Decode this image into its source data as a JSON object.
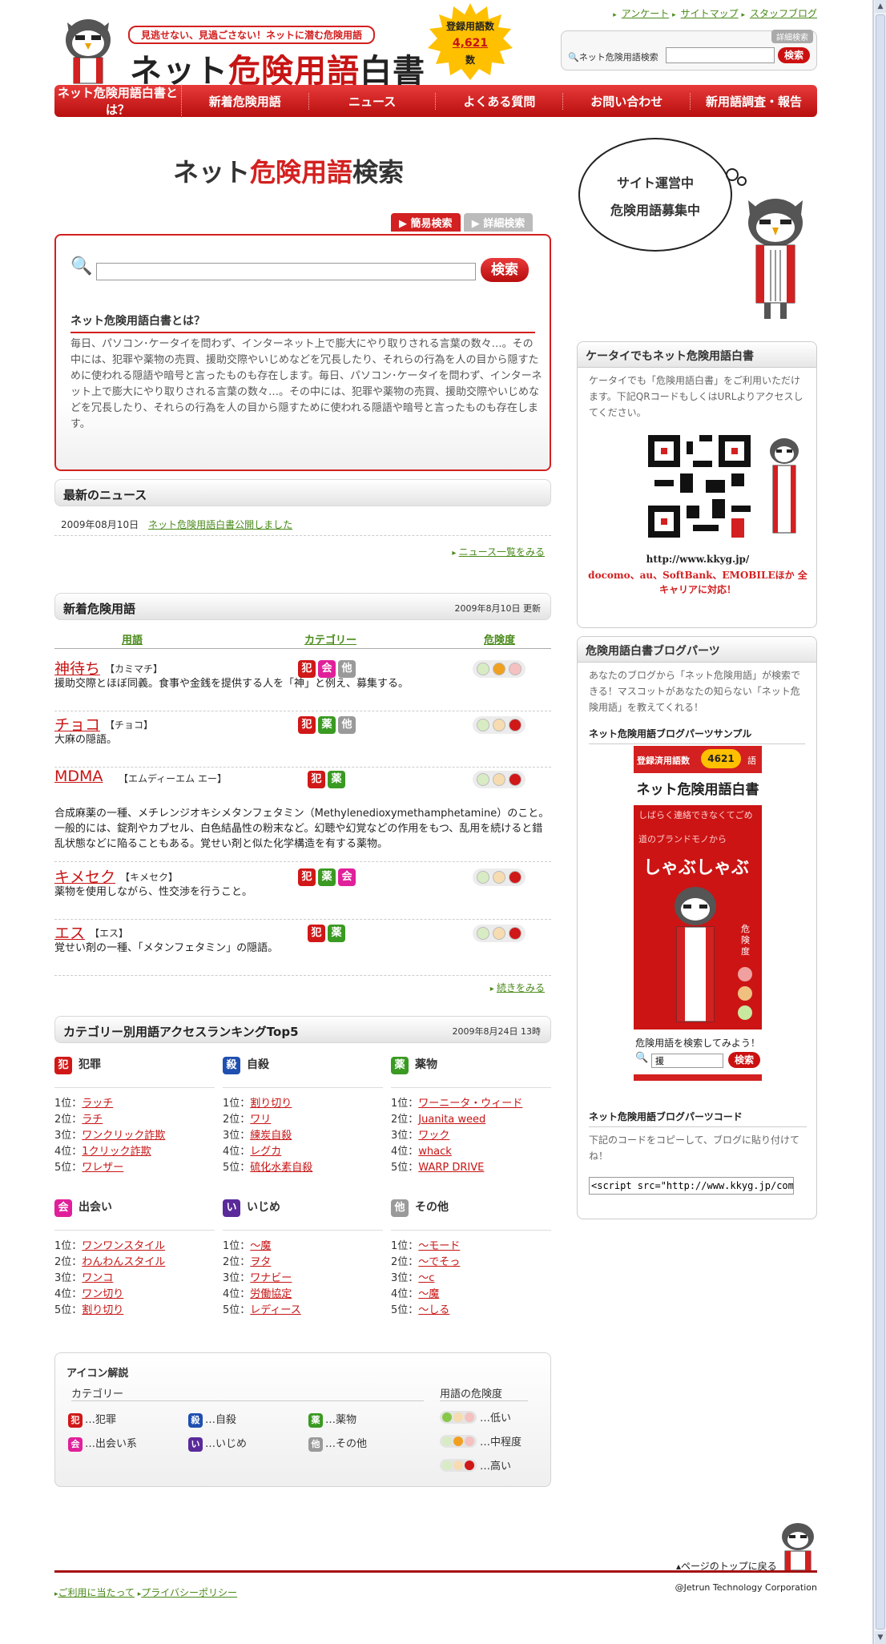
{
  "header": {
    "tagline": "見逃せない、見過ごさない！ネットに潜む危険用語",
    "logo_prefix": "ネット",
    "logo_red": "危険用語",
    "logo_suffix": "白書",
    "count_label": "登録用語数",
    "count_value": "4,621",
    "count_unit": "数",
    "top_links": [
      "アンケート",
      "サイトマップ",
      "スタッフブログ"
    ],
    "search_tab": "詳細検索",
    "search_label": "ネット危険用語検索",
    "search_button": "検索"
  },
  "nav": [
    "ネット危険用語白書とは？",
    "新着危険用語",
    "ニュース",
    "よくある質問",
    "お問い合わせ",
    "新用語調査・報告"
  ],
  "search": {
    "title_a": "ネット",
    "title_b": "危険用語",
    "title_c": "検索",
    "tab_simple": "簡易検索",
    "tab_detail": "詳細検索",
    "button": "検索",
    "about_title": "ネット危険用語白書とは？",
    "about_text": "毎日、パソコン･ケータイを問わず、インターネット上で膨大にやり取りされる言葉の数々…。その中には、犯罪や薬物の売買、援助交際やいじめなどを冗長したり、それらの行為を人の目から隠すために使われる隠語や暗号と言ったものも存在します。毎日、パソコン･ケータイを問わず、インターネット上で膨大にやり取りされる言葉の数々…。その中には、犯罪や薬物の売買、援助交際やいじめなどを冗長したり、それらの行為を人の目から隠すために使われる隠語や暗号と言ったものも存在します。"
  },
  "news": {
    "heading": "最新のニュース",
    "date": "2009年08月10日",
    "link": "ネット危険用語白書公開しました",
    "more": "ニュース一覧をみる"
  },
  "new_terms": {
    "heading": "新着危険用語",
    "updated": "2009年8月10日 更新",
    "col_term": "用語",
    "col_cat": "カテゴリー",
    "col_risk": "危険度",
    "more": "続きをみる",
    "items": [
      {
        "name": "神待ち",
        "kana": "【カミマチ】",
        "cats": [
          "犯",
          "会",
          "他"
        ],
        "risk": "middle",
        "desc": "援助交際とほぼ同義。食事や金銭を提供する人を「神」と例え、募集する。"
      },
      {
        "name": "チョコ",
        "kana": "【チョコ】",
        "cats": [
          "犯",
          "薬",
          "他"
        ],
        "risk": "high",
        "desc": "大麻の隠語。"
      },
      {
        "name": "MDMA",
        "kana": "【エムディーエム エー】",
        "cats": [
          "犯",
          "薬"
        ],
        "risk": "high",
        "desc": "合成麻薬の一種、メチレンジオキシメタンフェタミン（Methylenedioxymethamphetamine）のこと。一般的には、錠剤やカプセル、白色結晶性の粉末など。幻聴や幻覚などの作用をもつ、乱用を続けると錯乱状態などに陥ることもある。覚せい剤と似た化学構造を有する薬物。"
      },
      {
        "name": "キメセク",
        "kana": "【キメセク】",
        "cats": [
          "犯",
          "薬",
          "会"
        ],
        "risk": "high",
        "desc": "薬物を使用しながら、性交渉を行うこと。"
      },
      {
        "name": "エス",
        "kana": "【エス】",
        "cats": [
          "犯",
          "薬"
        ],
        "risk": "high",
        "desc": "覚せい剤の一種、「メタンフェタミン」の隠語。"
      }
    ]
  },
  "ranking": {
    "heading": "カテゴリー別用語アクセスランキングTop5",
    "date": "2009年8月24日 13時",
    "groups": [
      {
        "icon": "犯",
        "label": "犯罪",
        "items": [
          "ラッチ",
          "ラチ",
          "ワンクリック詐欺",
          "1クリック詐欺",
          "ワレザー"
        ]
      },
      {
        "icon": "殺",
        "label": "自殺",
        "items": [
          "割り切り",
          "ワリ",
          "練炭自殺",
          "レグカ",
          "硫化水素自殺"
        ]
      },
      {
        "icon": "薬",
        "label": "薬物",
        "items": [
          "ワーニータ・ウィード",
          "Juanita weed",
          "ワック",
          "whack",
          "WARP DRIVE"
        ]
      },
      {
        "icon": "会",
        "label": "出会い",
        "items": [
          "ワンワンスタイル",
          "わんわんスタイル",
          "ワンコ",
          "ワン切り",
          "割り切り"
        ]
      },
      {
        "icon": "い",
        "label": "いじめ",
        "items": [
          "～魔",
          "ヲタ",
          "ワナビー",
          "労働協定",
          "レディース"
        ]
      },
      {
        "icon": "他",
        "label": "その他",
        "items": [
          "～モード",
          "～でそっ",
          "～c",
          "～魔",
          "～しる"
        ]
      }
    ],
    "rank_suffix": "位："
  },
  "legend": {
    "heading": "アイコン解説",
    "cat_label": "カテゴリー",
    "risk_label": "用語の危険度",
    "cats": [
      {
        "icon": "犯",
        "label": "…犯罪"
      },
      {
        "icon": "殺",
        "label": "…自殺"
      },
      {
        "icon": "薬",
        "label": "…薬物"
      },
      {
        "icon": "会",
        "label": "…出会い系"
      },
      {
        "icon": "い",
        "label": "…いじめ"
      },
      {
        "icon": "他",
        "label": "…その他"
      }
    ],
    "risks": [
      "…低い",
      "…中程度",
      "…高い"
    ]
  },
  "side": {
    "bubble1": "サイト運営中",
    "bubble2": "危険用語募集中",
    "mobile_heading": "ケータイでもネット危険用語白書",
    "mobile_text": "ケータイでも「危険用語白書」をご利用いただけます。下記QRコードもしくはURLよりアクセスしてください。",
    "url": "http://www.kkyg.jp/",
    "carriers": "docomo、au、SoftBank、EMOBILEほか 全キャリアに対応！",
    "blog_heading": "危険用語白書ブログパーツ",
    "blog_text": "あなたのブログから「ネット危険用語」が検索できる！マスコットがあなたの知らない「ネット危険用語」を教えてくれる！",
    "sample_heading": "ネット危険用語ブログパーツサンプル",
    "widget_count_label": "登録済用語数",
    "widget_count": "4621",
    "widget_unit": "語",
    "widget_logo": "ネット危険用語白書",
    "widget_word": "しゃぶしゃぶ",
    "widget_line1": "しばらく連絡できなくてごめ",
    "widget_line2": "道のブランドモノから",
    "widget_risk": "危険度",
    "widget_prompt": "危険用語を検索してみよう！",
    "widget_input": "援",
    "widget_button": "検索",
    "code_heading": "ネット危険用語ブログパーツコード",
    "code_text": "下記のコードをコピーして、ブログに貼り付けてね！",
    "code_value": "<script src=\"http://www.kkyg.jp/common/js"
  },
  "footer": {
    "back_to_top": "ページのトップに戻る",
    "links": [
      "ご利用に当たって",
      "プライバシーポリシー"
    ],
    "copyright": "@Jetrun Technology Corporation"
  },
  "colors": {
    "red": "#d32020",
    "green": "#4a8a1a",
    "cat_犯": "#d01818",
    "cat_殺": "#1f4fb0",
    "cat_薬": "#3a9a22",
    "cat_会": "#e0209a",
    "cat_い": "#5a2a9a",
    "cat_他": "#9a9a9a"
  }
}
